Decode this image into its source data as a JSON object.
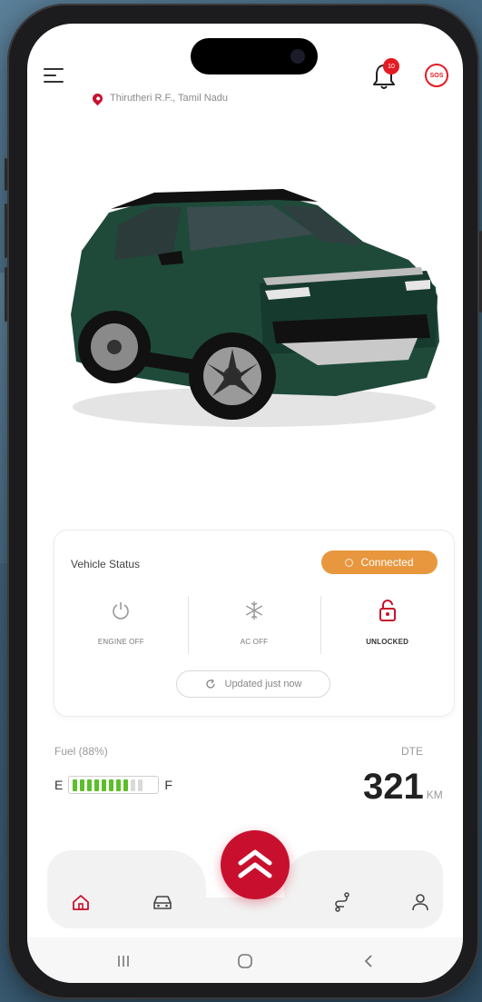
{
  "header": {
    "location": "Thirutheri R.F., Tamil Nadu",
    "notification_count": "10",
    "sos_label": "SOS"
  },
  "vehicle_status": {
    "title": "Vehicle Status",
    "connection": "Connected",
    "items": [
      {
        "label": "ENGINE OFF",
        "icon": "power-icon"
      },
      {
        "label": "AC OFF",
        "icon": "snowflake-icon"
      },
      {
        "label": "UNLOCKED",
        "icon": "unlock-icon"
      }
    ],
    "updated": "Updated just now"
  },
  "fuel": {
    "label": "Fuel (88%)",
    "percent": 88,
    "empty_mark": "E",
    "full_mark": "F",
    "segments_total": 10,
    "segments_filled": 8
  },
  "range": {
    "label": "DTE",
    "value": "321",
    "unit": "KM"
  },
  "nav": {
    "items": [
      "home-icon",
      "car-icon",
      "route-icon",
      "profile-icon"
    ],
    "active": "home-icon"
  },
  "colors": {
    "brand": "#c8102e",
    "connected": "#e8973f",
    "fuel_fill": "#5cbf2a",
    "car_body": "#1f4a3a"
  }
}
